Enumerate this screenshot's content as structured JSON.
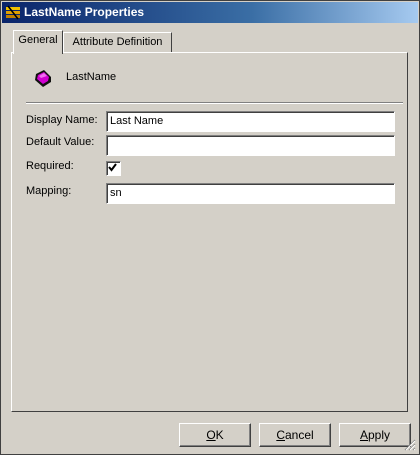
{
  "window": {
    "title": "LastName Properties"
  },
  "tabs": [
    {
      "label": "General",
      "active": true
    },
    {
      "label": "Attribute Definition",
      "active": false
    }
  ],
  "object": {
    "name": "LastName",
    "icon": "attribute-gem-icon"
  },
  "form": {
    "display_name": {
      "label": "Display Name:",
      "value": "Last Name"
    },
    "default_value": {
      "label": "Default Value:",
      "value": ""
    },
    "required": {
      "label": "Required:",
      "checked": true
    },
    "mapping": {
      "label": "Mapping:",
      "value": "sn"
    }
  },
  "buttons": {
    "ok": {
      "first": "O",
      "rest": "K"
    },
    "cancel": {
      "first": "C",
      "rest": "ancel"
    },
    "apply": {
      "first": "A",
      "rest": "pply"
    }
  },
  "colors": {
    "titlebar_start": "#0a246a",
    "titlebar_end": "#a6caf0",
    "icon_magenta": "#d000d0"
  }
}
